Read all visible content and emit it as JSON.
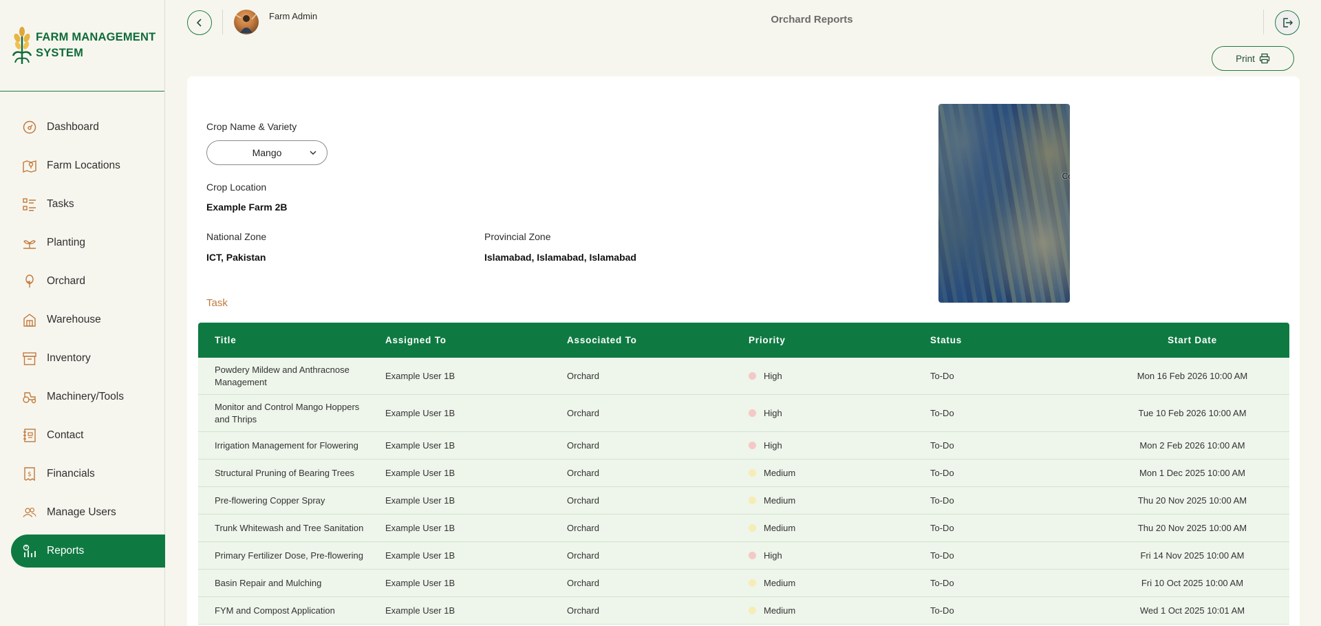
{
  "app": {
    "brand_line1": "FARM MANAGEMENT",
    "brand_line2": "SYSTEM"
  },
  "sidebar": {
    "items": [
      {
        "label": "Dashboard",
        "icon": "gauge-icon"
      },
      {
        "label": "Farm Locations",
        "icon": "map-pin-icon"
      },
      {
        "label": "Tasks",
        "icon": "task-list-icon"
      },
      {
        "label": "Planting",
        "icon": "sprout-icon"
      },
      {
        "label": "Orchard",
        "icon": "tree-icon"
      },
      {
        "label": "Warehouse",
        "icon": "warehouse-icon"
      },
      {
        "label": "Inventory",
        "icon": "archive-box-icon"
      },
      {
        "label": "Machinery/Tools",
        "icon": "tractor-icon"
      },
      {
        "label": "Contact",
        "icon": "contact-book-icon"
      },
      {
        "label": "Financials",
        "icon": "dollar-receipt-icon"
      },
      {
        "label": "Manage Users",
        "icon": "users-icon"
      },
      {
        "label": "Reports",
        "icon": "report-chart-icon",
        "active": true
      }
    ]
  },
  "header": {
    "user_name": "Farm Admin",
    "title": "Orchard Reports"
  },
  "toolbar": {
    "print_label": "Print"
  },
  "form": {
    "crop_label": "Crop Name & Variety",
    "crop_value": "Mango",
    "location_label": "Crop Location",
    "location_value": "Example Farm 2B",
    "national_label": "National Zone",
    "national_value": "ICT, Pakistan",
    "provincial_label": "Provincial Zone",
    "provincial_value": "Islamabad, Islamabad, Islamabad"
  },
  "map": {
    "label_fragment": "Co"
  },
  "task_section": {
    "title": "Task"
  },
  "table": {
    "headers": [
      "Title",
      "Assigned To",
      "Associated To",
      "Priority",
      "Status",
      "Start Date"
    ],
    "rows": [
      {
        "title": "Powdery Mildew and Anthracnose Management",
        "assigned": "Example User 1B",
        "associated": "Orchard",
        "priority": "High",
        "status": "To-Do",
        "start": "Mon 16 Feb 2026 10:00 AM"
      },
      {
        "title": "Monitor and Control Mango Hoppers and Thrips",
        "assigned": "Example User 1B",
        "associated": "Orchard",
        "priority": "High",
        "status": "To-Do",
        "start": "Tue 10 Feb 2026 10:00 AM"
      },
      {
        "title": "Irrigation Management for Flowering",
        "assigned": "Example User 1B",
        "associated": "Orchard",
        "priority": "High",
        "status": "To-Do",
        "start": "Mon 2 Feb 2026 10:00 AM"
      },
      {
        "title": "Structural Pruning of Bearing Trees",
        "assigned": "Example User 1B",
        "associated": "Orchard",
        "priority": "Medium",
        "status": "To-Do",
        "start": "Mon 1 Dec 2025 10:00 AM"
      },
      {
        "title": "Pre-flowering Copper Spray",
        "assigned": "Example User 1B",
        "associated": "Orchard",
        "priority": "Medium",
        "status": "To-Do",
        "start": "Thu 20 Nov 2025 10:00 AM"
      },
      {
        "title": "Trunk Whitewash and Tree Sanitation",
        "assigned": "Example User 1B",
        "associated": "Orchard",
        "priority": "Medium",
        "status": "To-Do",
        "start": "Thu 20 Nov 2025 10:00 AM"
      },
      {
        "title": "Primary Fertilizer Dose, Pre-flowering",
        "assigned": "Example User 1B",
        "associated": "Orchard",
        "priority": "High",
        "status": "To-Do",
        "start": "Fri 14 Nov 2025 10:00 AM"
      },
      {
        "title": "Basin Repair and Mulching",
        "assigned": "Example User 1B",
        "associated": "Orchard",
        "priority": "Medium",
        "status": "To-Do",
        "start": "Fri 10 Oct 2025 10:00 AM"
      },
      {
        "title": "FYM and Compost Application",
        "assigned": "Example User 1B",
        "associated": "Orchard",
        "priority": "Medium",
        "status": "To-Do",
        "start": "Wed 1 Oct 2025 10:01 AM"
      }
    ]
  },
  "colors": {
    "primary": "#0e7a41",
    "accent": "#c0793d",
    "background": "#f7f6ee",
    "row_bg": "#eef5ea",
    "high": "#f5c8c8",
    "medium": "#f6ecb6"
  }
}
